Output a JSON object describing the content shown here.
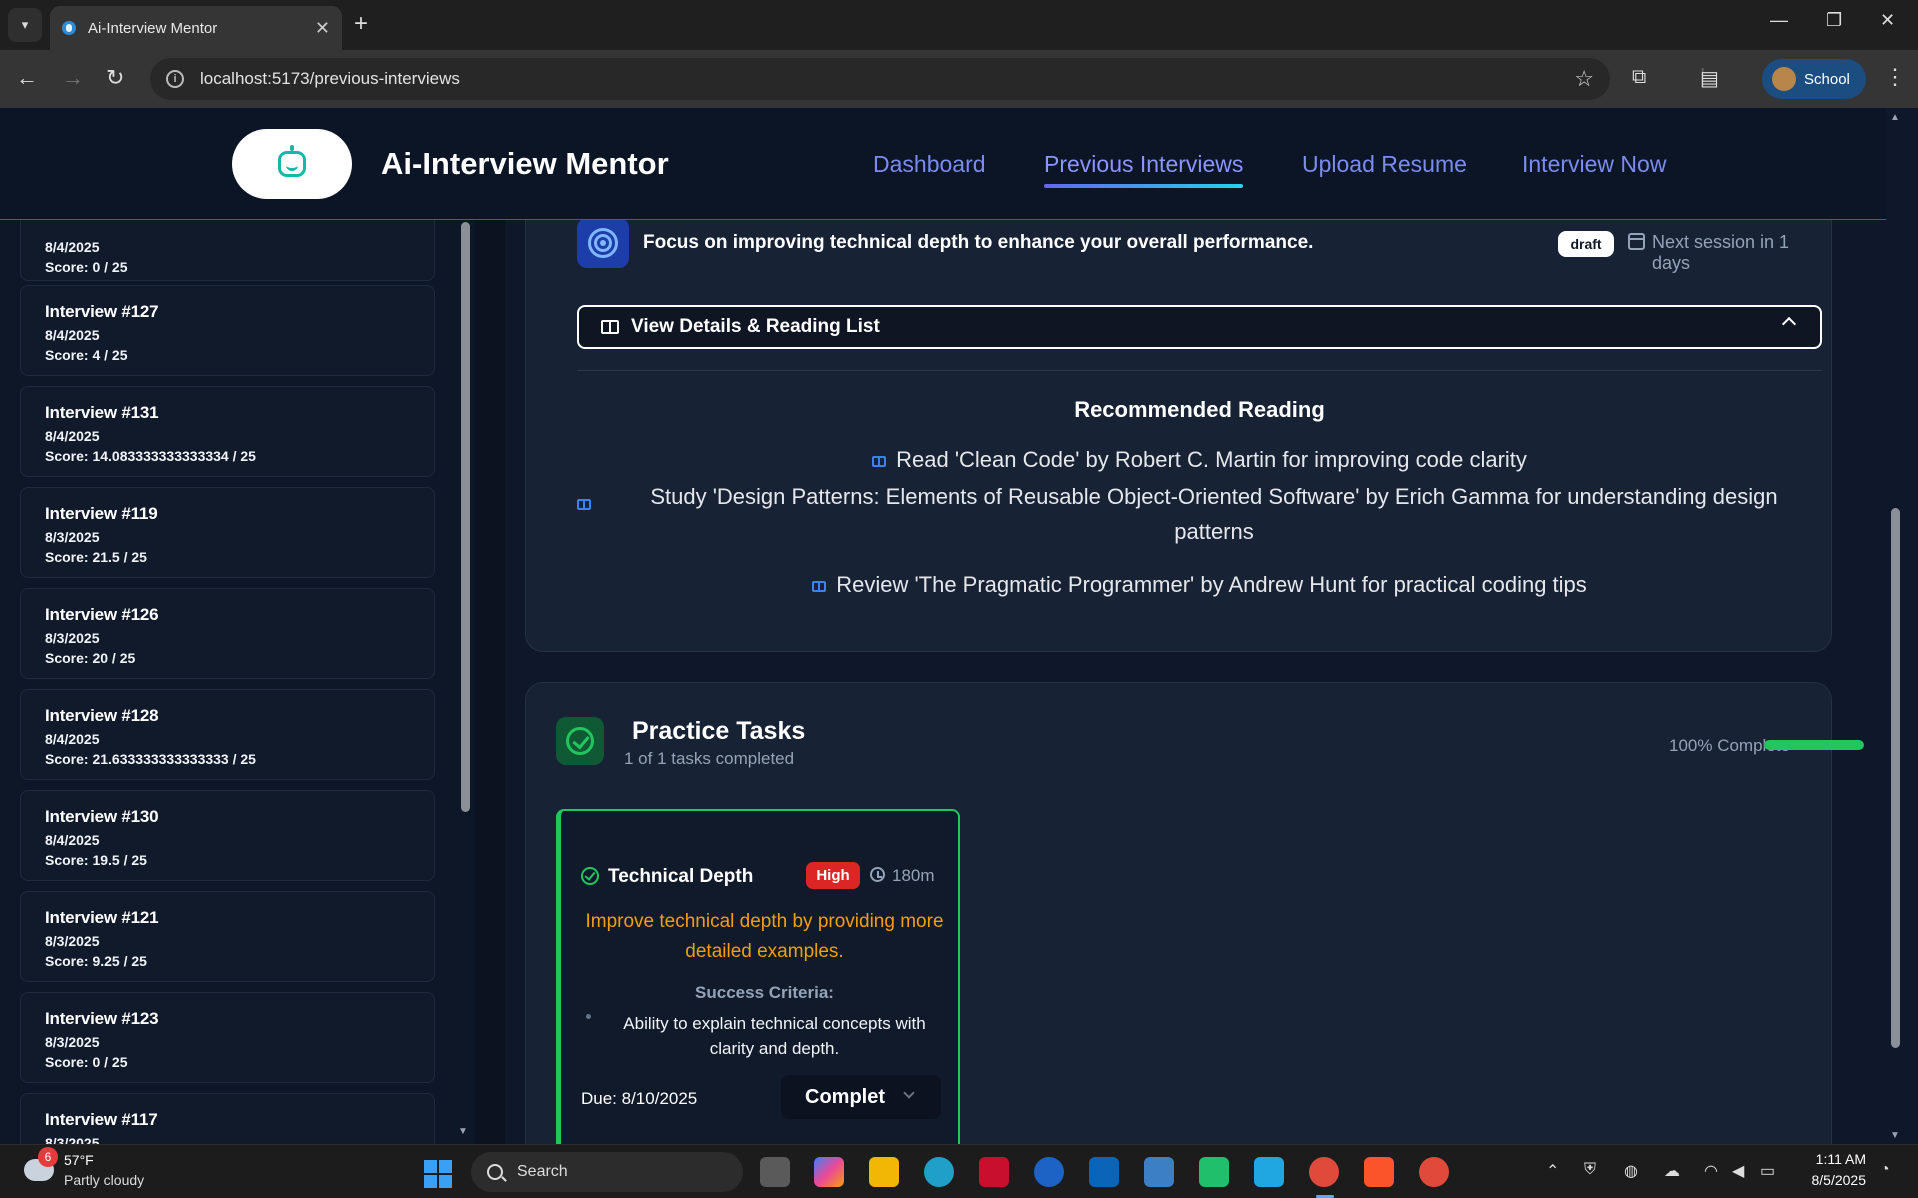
{
  "browser": {
    "tab_title": "Ai-Interview Mentor",
    "url": "localhost:5173/previous-interviews",
    "profile_label": "School"
  },
  "header": {
    "app_title": "Ai-Interview Mentor",
    "nav": [
      {
        "label": "Dashboard"
      },
      {
        "label": "Previous Interviews",
        "active": true
      },
      {
        "label": "Upload Resume"
      },
      {
        "label": "Interview Now"
      }
    ]
  },
  "sidebar": {
    "partial_first": {
      "date": "8/4/2025",
      "score": "Score: 0 / 25"
    },
    "interviews": [
      {
        "title": "Interview #127",
        "date": "8/4/2025",
        "score": "Score: 4 / 25"
      },
      {
        "title": "Interview #131",
        "date": "8/4/2025",
        "score": "Score: 14.083333333333334 / 25"
      },
      {
        "title": "Interview #119",
        "date": "8/3/2025",
        "score": "Score: 21.5 / 25"
      },
      {
        "title": "Interview #126",
        "date": "8/3/2025",
        "score": "Score: 20 / 25"
      },
      {
        "title": "Interview #128",
        "date": "8/4/2025",
        "score": "Score: 21.633333333333333 / 25"
      },
      {
        "title": "Interview #130",
        "date": "8/4/2025",
        "score": "Score: 19.5 / 25"
      },
      {
        "title": "Interview #121",
        "date": "8/3/2025",
        "score": "Score: 9.25 / 25"
      },
      {
        "title": "Interview #123",
        "date": "8/3/2025",
        "score": "Score: 0 / 25"
      },
      {
        "title": "Interview #117",
        "date": "8/3/2025",
        "score": ""
      }
    ]
  },
  "focus": {
    "text": "Focus on improving technical depth to enhance your overall performance.",
    "badge": "draft",
    "next_session": "Next session in 1 days",
    "details_button": "View Details & Reading List"
  },
  "reading": {
    "title": "Recommended Reading",
    "items": [
      "Read 'Clean Code' by Robert C. Martin for improving code clarity",
      "Study 'Design Patterns: Elements of Reusable Object-Oriented Software' by Erich Gamma for understanding design patterns",
      "Review 'The Pragmatic Programmer' by Andrew Hunt for practical coding tips"
    ]
  },
  "practice": {
    "title": "Practice Tasks",
    "subtitle": "1 of 1 tasks completed",
    "progress_label": "100% Complete",
    "progress_fraction": 1.0,
    "task": {
      "title": "Technical Depth",
      "priority": "High",
      "duration": "180m",
      "description": "Improve technical depth by providing more detailed examples.",
      "criteria_label": "Success Criteria:",
      "criteria": "Ability to explain technical concepts with clarity and depth.",
      "due": "Due: 8/10/2025",
      "status": "Completed"
    }
  },
  "taskbar": {
    "weather_badge": "6",
    "temperature": "57°F",
    "weather": "Partly cloudy",
    "search_label": "Search",
    "time": "1:11 AM",
    "date": "8/5/2025"
  },
  "colors": {
    "accent_nav": "#7b8cf0",
    "success": "#22c55e",
    "priority_high": "#dc2626",
    "description": "#f59e0b"
  }
}
